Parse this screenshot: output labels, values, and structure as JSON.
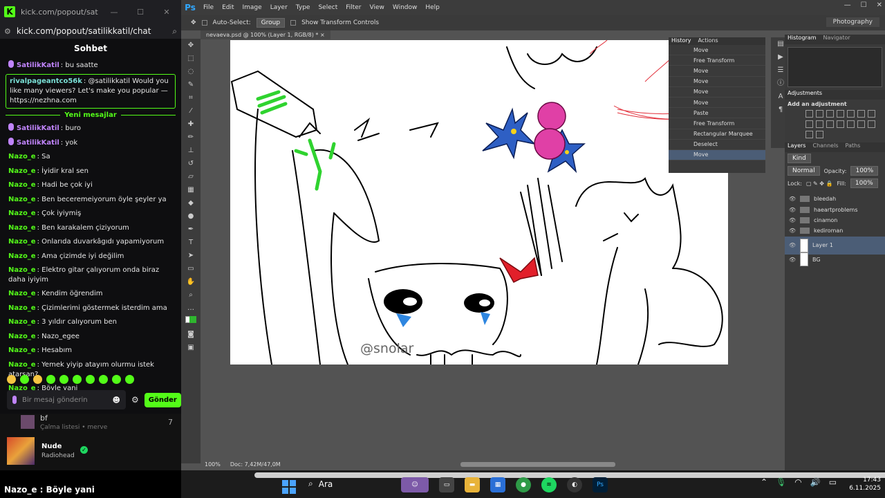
{
  "chat": {
    "title": "kick.com/popout/satilikkatil/...",
    "url": "kick.com/popout/satilikkatil/chat",
    "header": "Sohbet",
    "new_messages": "Yeni mesajlar",
    "messages": [
      {
        "user": "SatilikKatil",
        "text": "bu saatte",
        "color": "purple",
        "badge": true
      },
      {
        "user": "rivalpageantco56k",
        "text": "@satilikkatil Would you like many viewers? Let's make you popular — https://nezhna.com",
        "color": "cyan",
        "boxed": true
      },
      {
        "user": "SatilikKatil",
        "text": "buro",
        "color": "purple",
        "badge": true
      },
      {
        "user": "SatilikKatil",
        "text": "yok",
        "color": "purple",
        "badge": true
      },
      {
        "user": "Nazo_e",
        "text": "Sa"
      },
      {
        "user": "Nazo_e",
        "text": "İyidir kral sen"
      },
      {
        "user": "Nazo_e",
        "text": "Hadi be çok iyi"
      },
      {
        "user": "Nazo_e",
        "text": "Ben beceremeiyorum öyle şeyler ya"
      },
      {
        "user": "Nazo_e",
        "text": "Çok iyiymiş"
      },
      {
        "user": "Nazo_e",
        "text": "Ben karakalem çiziyorum"
      },
      {
        "user": "Nazo_e",
        "text": "Onlarıda duvarkâgıdı yapamiyorum"
      },
      {
        "user": "Nazo_e",
        "text": "Ama çizimde iyi değilim"
      },
      {
        "user": "Nazo_e",
        "text": "Elektro gitar çalıyorum onda biraz daha iyiyim"
      },
      {
        "user": "Nazo_e",
        "text": "Kendim öğrendim"
      },
      {
        "user": "Nazo_e",
        "text": "Çizimlerimi göstermek isterdim ama"
      },
      {
        "user": "Nazo_e",
        "text": "3 yıldır calıyorum ben"
      },
      {
        "user": "Nazo_e",
        "text": "Nazo_egee"
      },
      {
        "user": "Nazo_e",
        "text": "Hesabım"
      },
      {
        "user": "Nazo_e",
        "text": "Yemek yiyip atayım olurmu istek atarsan?"
      },
      {
        "user": "Nazo_e",
        "text": "Böyle yani"
      }
    ],
    "input_placeholder": "Bir mesaj gönderin",
    "send_label": "Gönder"
  },
  "spotify": {
    "row_title": "bf",
    "row_sub": "Çalma listesi • merve",
    "row_num": "7",
    "track": "Nude",
    "artist": "Radiohead"
  },
  "caption": "Nazo_e : Böyle yani",
  "photoshop": {
    "menu": [
      "File",
      "Edit",
      "Image",
      "Layer",
      "Type",
      "Select",
      "Filter",
      "View",
      "Window",
      "Help"
    ],
    "auto_select_label": "Auto-Select:",
    "auto_select_value": "Group",
    "show_transform_label": "Show Transform Controls",
    "workspace": "Photography",
    "doc_tab": "nevaeva.psd @ 100% (Layer 1, RGB/8) *",
    "watermark": "@snolar",
    "zoom": "100%",
    "doc_size": "Doc: 7,42M/47,0M",
    "history_tabs": [
      "History",
      "Actions"
    ],
    "history": [
      "Move",
      "Free Transform",
      "Move",
      "Move",
      "Move",
      "Move",
      "Paste",
      "Free Transform",
      "Rectangular Marquee",
      "Deselect",
      "Move"
    ],
    "panel_tabs_top": [
      "Histogram",
      "Navigator"
    ],
    "adjustments_tab": "Adjustments",
    "add_adjustment": "Add an adjustment",
    "layer_tabs": [
      "Layers",
      "Channels",
      "Paths"
    ],
    "kind": "Kind",
    "blend": "Normal",
    "opacity_label": "Opacity:",
    "opacity": "100%",
    "lock_label": "Lock:",
    "fill_label": "Fill:",
    "fill": "100%",
    "layers": [
      "bleedah",
      "haeartproblems",
      "cinamon",
      "kediroman",
      "Layer 1",
      "BG"
    ]
  },
  "taskbar": {
    "search": "Ara",
    "time": "17:43",
    "date": "6.11.2025"
  },
  "colors": {
    "kick_green": "#53fc18",
    "mod_purple": "#c084fc",
    "ps_panel": "#3a3a3a",
    "selection_blue": "#4b5d76"
  }
}
